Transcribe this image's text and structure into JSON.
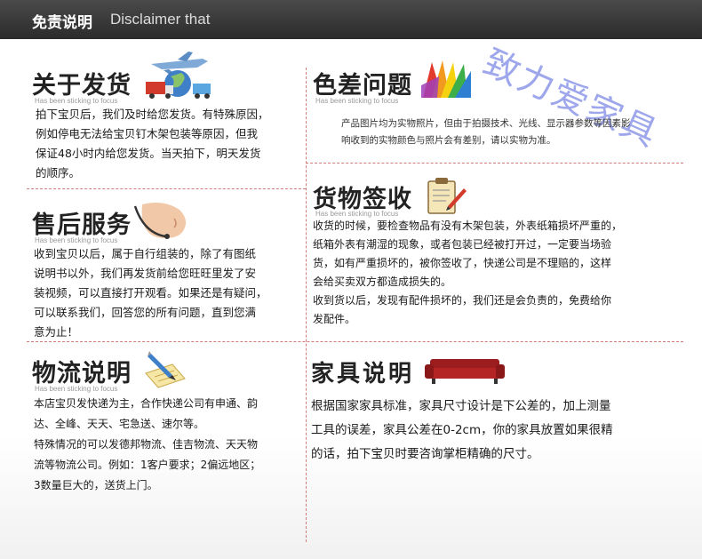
{
  "header": {
    "title": "免责说明",
    "subtitle": "Disclaimer that"
  },
  "watermark": "致力爱家具",
  "sections": {
    "shipping": {
      "title": "关于发货",
      "subtitle": "Has been sticking to focus",
      "lines": [
        "拍下宝贝后，我们及时给您发货。有特殊原因，",
        "例如停电无法给宝贝钉木架包装等原因，但我",
        "保证48小时内给您发货。当天拍下，明天发货",
        "的顺序。"
      ]
    },
    "color": {
      "title": "色差问题",
      "subtitle": "Has been sticking to focus",
      "lines": [
        "产品图片均为实物照片，但由于拍摄技术、光线、显示器参数等因素影",
        "响收到的实物颜色与照片会有差别，请以实物为准。"
      ]
    },
    "aftersale": {
      "title": "售后服务",
      "subtitle": "Has been sticking to focus",
      "lines": [
        "收到宝贝以后，属于自行组装的，除了有图纸",
        "说明书以外，我们再发货前给您旺旺里发了安",
        "装视频，可以直接打开观看。如果还是有疑问，",
        "可以联系我们，回答您的所有问题，直到您满",
        "意为止！"
      ]
    },
    "receipt": {
      "title": "货物签收",
      "subtitle": "Has been sticking to focus",
      "lines": [
        "收货的时候，要检查物品有没有木架包装，外表纸箱损坏严重的，",
        "纸箱外表有潮湿的现象，或者包装已经被打开过，一定要当场验",
        "货，如有严重损坏的，被你签收了，快递公司是不理赔的，这样",
        "会给买卖双方都造成损失的。",
        "收到货以后，发现有配件损坏的，我们还是会负责的，免费给你",
        "发配件。"
      ]
    },
    "logistics": {
      "title": "物流说明",
      "subtitle": "Has been sticking to focus",
      "lines": [
        "本店宝贝发快递为主，合作快递公司有申通、韵",
        "达、全峰、天天、宅急送、速尔等。",
        "特殊情况的可以发德邦物流、佳吉物流、天天物",
        "流等物流公司。例如：1客户要求；2偏远地区；",
        "3数量巨大的，送货上门。"
      ]
    },
    "furniture": {
      "title": "家具说明",
      "lines": [
        "根据国家家具标准，家具尺寸设计是下公差的，加上测量",
        "工具的误差，家具公差在0-2cm，你的家具放置如果很精",
        "的话，拍下宝贝时要咨询掌柜精确的尺寸。"
      ]
    }
  },
  "icons": {
    "shipping": "airplane-globe-truck-icon",
    "color": "color-palette-icon",
    "aftersale": "customer-service-headset-icon",
    "receipt": "clipboard-sign-icon",
    "logistics": "pen-writing-icon",
    "furniture": "sofa-icon"
  }
}
